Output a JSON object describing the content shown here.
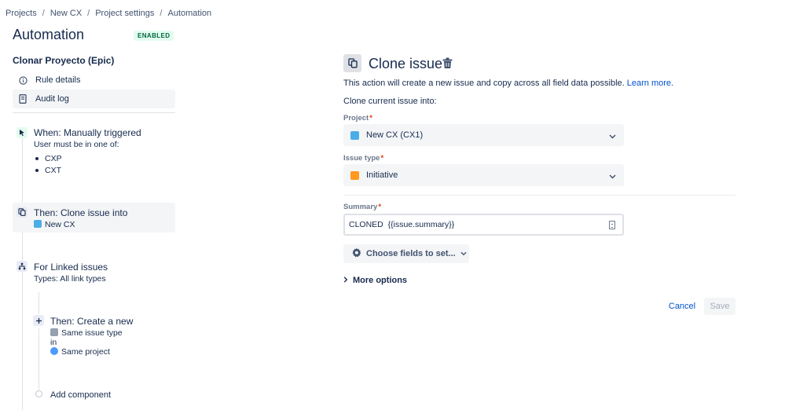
{
  "breadcrumb": [
    "Projects",
    "New CX",
    "Project settings",
    "Automation"
  ],
  "breadcrumb_separator": "/",
  "page": {
    "title": "Automation",
    "status_badge": "ENABLED"
  },
  "rule": {
    "name": "Clonar Proyecto (Epic)"
  },
  "nav": {
    "rule_details": "Rule details",
    "audit_log": "Audit log"
  },
  "components": {
    "trigger": {
      "title": "When: Manually triggered",
      "subtitle": "User must be in one of:",
      "groups": [
        "CXP",
        "CXT"
      ]
    },
    "clone": {
      "title": "Then: Clone issue into",
      "target": "New CX"
    },
    "branch": {
      "title": "For Linked issues",
      "subtitle": "Types: All link types"
    },
    "create": {
      "title": "Then: Create a new",
      "line1": "Same issue type",
      "line2": "in",
      "line3": "Same project"
    },
    "add_component": "Add component"
  },
  "panel": {
    "title": "Clone issue",
    "description": "This action will create a new issue and copy across all field data possible.",
    "learn_more": "Learn more.",
    "clone_into": "Clone current issue into:",
    "project_label": "Project",
    "project_value": "New CX (CX1)",
    "issue_type_label": "Issue type",
    "issue_type_value": "Initiative",
    "summary_label": "Summary",
    "summary_value": "CLONED  {{issue.summary}}",
    "choose_fields": "Choose fields to set...",
    "more_options": "More options",
    "required_marker": "*",
    "cancel": "Cancel",
    "save": "Save"
  },
  "colors": {
    "link": "#0052cc",
    "badge_bg": "#e3fcef",
    "badge_text": "#006644",
    "project_icon": "#4bade8",
    "initiative_icon": "#ff991f",
    "required": "#de350b"
  },
  "icons": {
    "rule_details": "info-icon",
    "audit_log": "document-icon",
    "trigger": "cursor-click-icon",
    "clone": "copy-icon",
    "branch": "hierarchy-icon",
    "create": "plus-icon",
    "trash": "trash-icon",
    "settings": "gear-icon"
  }
}
